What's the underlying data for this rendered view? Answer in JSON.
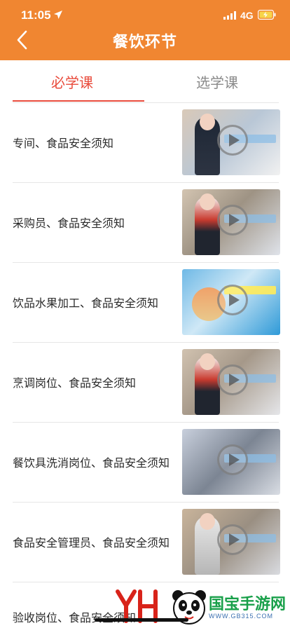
{
  "status_bar": {
    "time": "11:05",
    "network": "4G"
  },
  "header": {
    "title": "餐饮环节",
    "background_color": "#f08631",
    "back_icon": "chevron-left-icon"
  },
  "tabs": [
    {
      "label": "必学课",
      "active": true,
      "color": "#e94b3c"
    },
    {
      "label": "选学课",
      "active": false,
      "color": "#8a8a8a"
    }
  ],
  "courses": [
    {
      "title": "专间、食品安全须知",
      "thumbnail_icon": "play-icon"
    },
    {
      "title": "采购员、食品安全须知",
      "thumbnail_icon": "play-icon"
    },
    {
      "title": "饮品水果加工、食品安全须知",
      "thumbnail_icon": "play-icon"
    },
    {
      "title": "烹调岗位、食品安全须知",
      "thumbnail_icon": "play-icon"
    },
    {
      "title": "餐饮具洗消岗位、食品安全须知",
      "thumbnail_icon": "play-icon"
    },
    {
      "title": "食品安全管理员、食品安全须知",
      "thumbnail_icon": "play-icon"
    },
    {
      "title": "验收岗位、食品安全须知",
      "thumbnail_icon": "play-icon"
    }
  ],
  "watermark": {
    "site_name": "国宝手游网",
    "url": "WWW.GB315.COM"
  }
}
